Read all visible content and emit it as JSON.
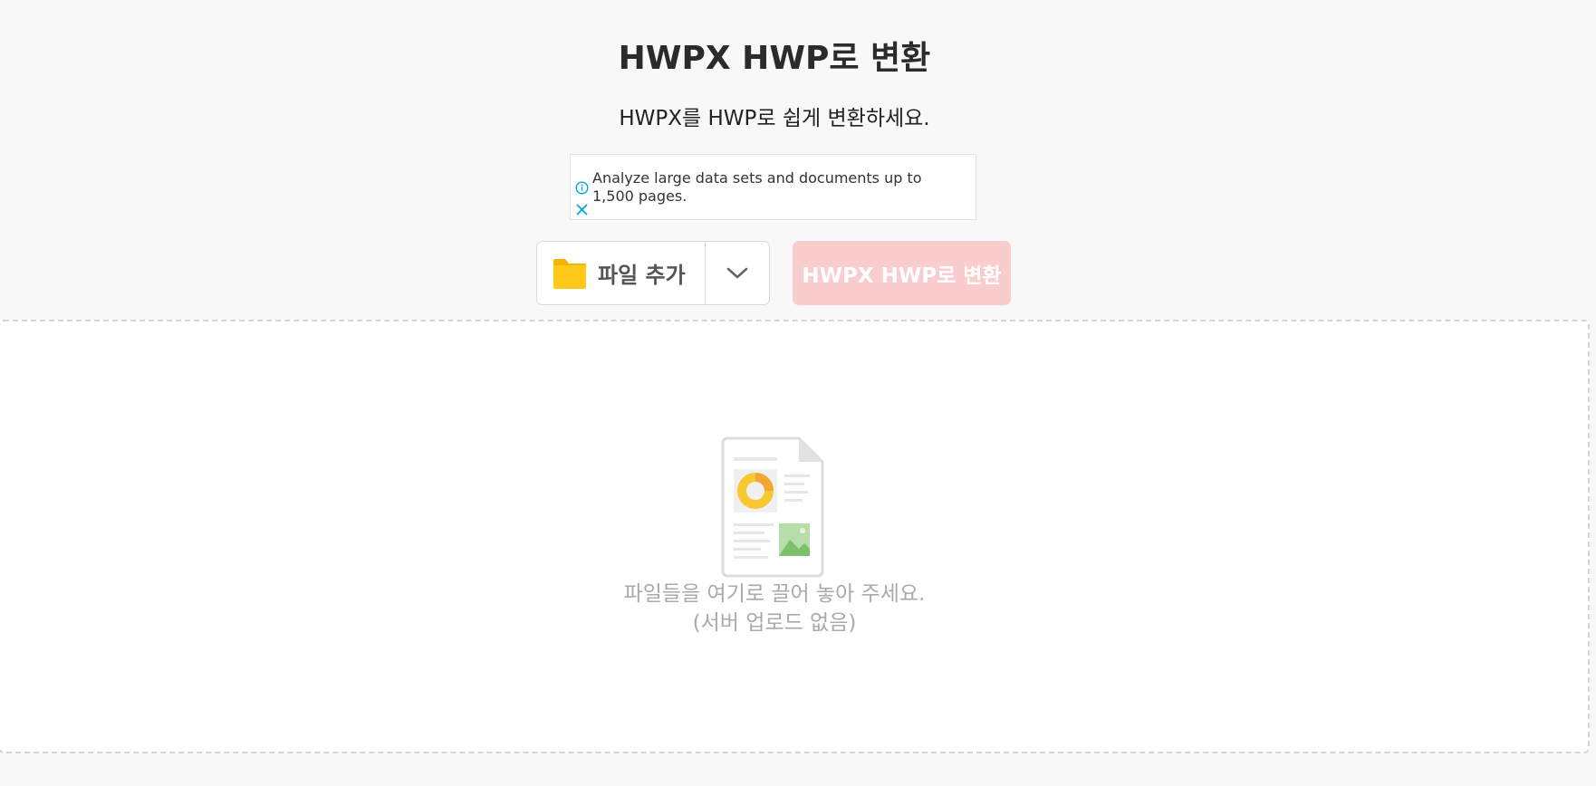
{
  "header": {
    "title": "HWPX HWP로 변환",
    "subtitle": "HWPX를 HWP로 쉽게 변환하세요."
  },
  "ad": {
    "text": "Analyze large data sets and documents up to 1,500 pages.",
    "info_icon": "info-icon",
    "close_icon": "close-icon"
  },
  "toolbar": {
    "add_file_label": "파일 추가",
    "dropdown_icon": "chevron-down-icon",
    "convert_label": "HWPX HWP로 변환"
  },
  "dropzone": {
    "line1": "파일들을 여기로 끌어 놓아 주세요.",
    "line2": "(서버 업로드 없음)"
  },
  "colors": {
    "background": "#f8f8f8",
    "convert_button_disabled": "#f9cdcd",
    "folder": "#ffc107",
    "ad_accent": "#00a9e0"
  }
}
